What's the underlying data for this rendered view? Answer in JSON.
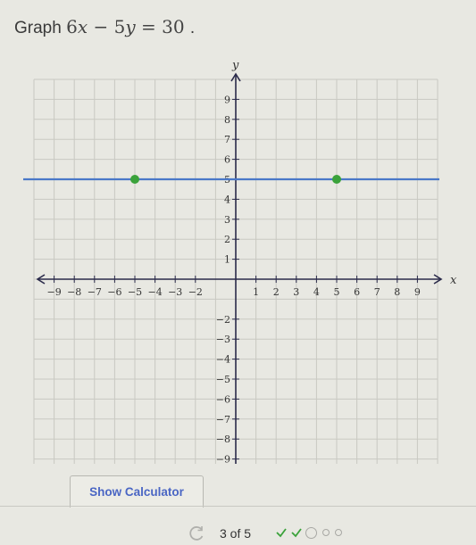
{
  "prompt": {
    "label": "Graph",
    "equation_parts": [
      "6",
      "x",
      " − 5",
      "y",
      " = 30"
    ],
    "period": "."
  },
  "graph": {
    "x_axis_label": "x",
    "y_axis_label": "y",
    "x_range": [
      -10,
      10
    ],
    "y_range": [
      -10,
      10
    ],
    "x_ticks": [
      -9,
      -8,
      -7,
      -6,
      -5,
      -4,
      -3,
      -2,
      1,
      2,
      3,
      4,
      5,
      6,
      7,
      8,
      9
    ],
    "y_ticks": [
      9,
      8,
      7,
      6,
      5,
      4,
      3,
      2,
      1,
      -2,
      -3,
      -4,
      -5,
      -6,
      -7,
      -8,
      -9
    ],
    "plotted_line": {
      "type": "horizontal",
      "y": 5,
      "color": "#4a78c8"
    },
    "plotted_points": [
      {
        "x": -5,
        "y": 5,
        "color": "#3aa23a"
      },
      {
        "x": 5,
        "y": 5,
        "color": "#3aa23a"
      }
    ],
    "axis_color": "#2a2a4a",
    "grid_color": "#c9c9c2"
  },
  "buttons": {
    "show_calculator": "Show Calculator"
  },
  "footer": {
    "progress_text": "3 of 5",
    "progress": [
      "done",
      "done",
      "current",
      "todo",
      "todo"
    ],
    "check_color": "#3aa23a"
  }
}
